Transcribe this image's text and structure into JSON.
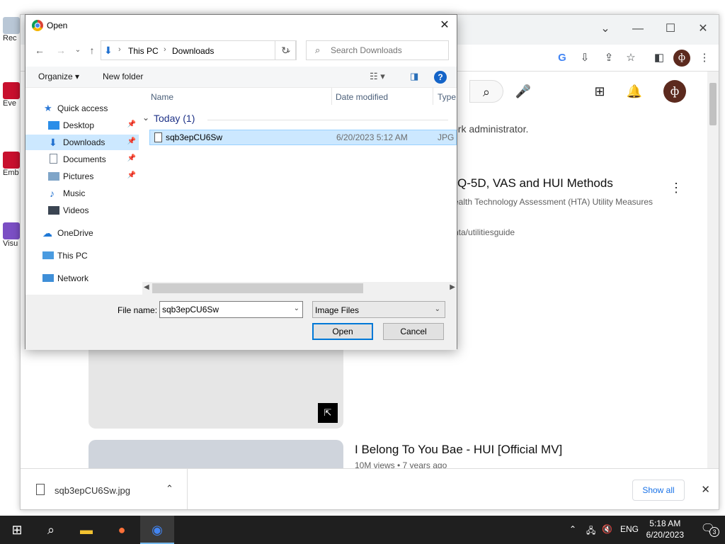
{
  "desktop": {
    "icons": [
      {
        "label": "Rec",
        "icon": "recycle-bin-icon"
      },
      {
        "label": "Eve",
        "icon": "app-icon"
      },
      {
        "label": "Emb De",
        "icon": "app-icon"
      },
      {
        "label": "Visu",
        "icon": "visual-studio-icon"
      }
    ]
  },
  "chrome": {
    "window_controls": {
      "minimize": "—",
      "maximize": "☐",
      "close": "✕",
      "tab_dropdown": "⌄"
    },
    "page": {
      "notice_text": "ork administrator.",
      "video1_title": "Q-5D, VAS and HUI Methods",
      "video1_subtitle": "ealth Technology Assessment (HTA) Utility Measures",
      "video1_url": "hta/utilitiesguide",
      "video2_title": "I Belong To You Bae - HUI [Official MV]",
      "video2_meta": "10M views • 7 years ago",
      "avatar_letter": "ф"
    },
    "download_bar": {
      "file": "sqb3epCU6Sw.jpg",
      "show_all": "Show all"
    }
  },
  "dialog": {
    "title": "Open",
    "breadcrumb": [
      "This PC",
      "Downloads"
    ],
    "search_placeholder": "Search Downloads",
    "toolbar": {
      "organize": "Organize ▾",
      "new_folder": "New folder",
      "help": "?"
    },
    "nav": [
      {
        "label": "Quick access",
        "icon": "star-icon",
        "pinned": false
      },
      {
        "label": "Desktop",
        "icon": "desktop-icon",
        "pinned": true
      },
      {
        "label": "Downloads",
        "icon": "download-icon",
        "pinned": true,
        "selected": true
      },
      {
        "label": "Documents",
        "icon": "documents-icon",
        "pinned": true
      },
      {
        "label": "Pictures",
        "icon": "pictures-icon",
        "pinned": true
      },
      {
        "label": "Music",
        "icon": "music-icon",
        "pinned": false
      },
      {
        "label": "Videos",
        "icon": "videos-icon",
        "pinned": false
      },
      {
        "label": "OneDrive",
        "icon": "cloud-icon",
        "pinned": false
      },
      {
        "label": "This PC",
        "icon": "computer-icon",
        "pinned": false
      },
      {
        "label": "Network",
        "icon": "network-icon",
        "pinned": false
      }
    ],
    "columns": [
      "Name",
      "Date modified",
      "Type"
    ],
    "group": "Today (1)",
    "files": [
      {
        "name": "sqb3epCU6Sw",
        "date": "6/20/2023 5:12 AM",
        "type": "JPG F"
      }
    ],
    "file_name_label": "File name:",
    "file_name_value": "sqb3epCU6Sw",
    "file_type": "Image Files",
    "open_label": "Open",
    "cancel_label": "Cancel"
  },
  "taskbar": {
    "time": "5:18 AM",
    "date": "6/20/2023",
    "lang": "ENG",
    "notifications": "3"
  }
}
